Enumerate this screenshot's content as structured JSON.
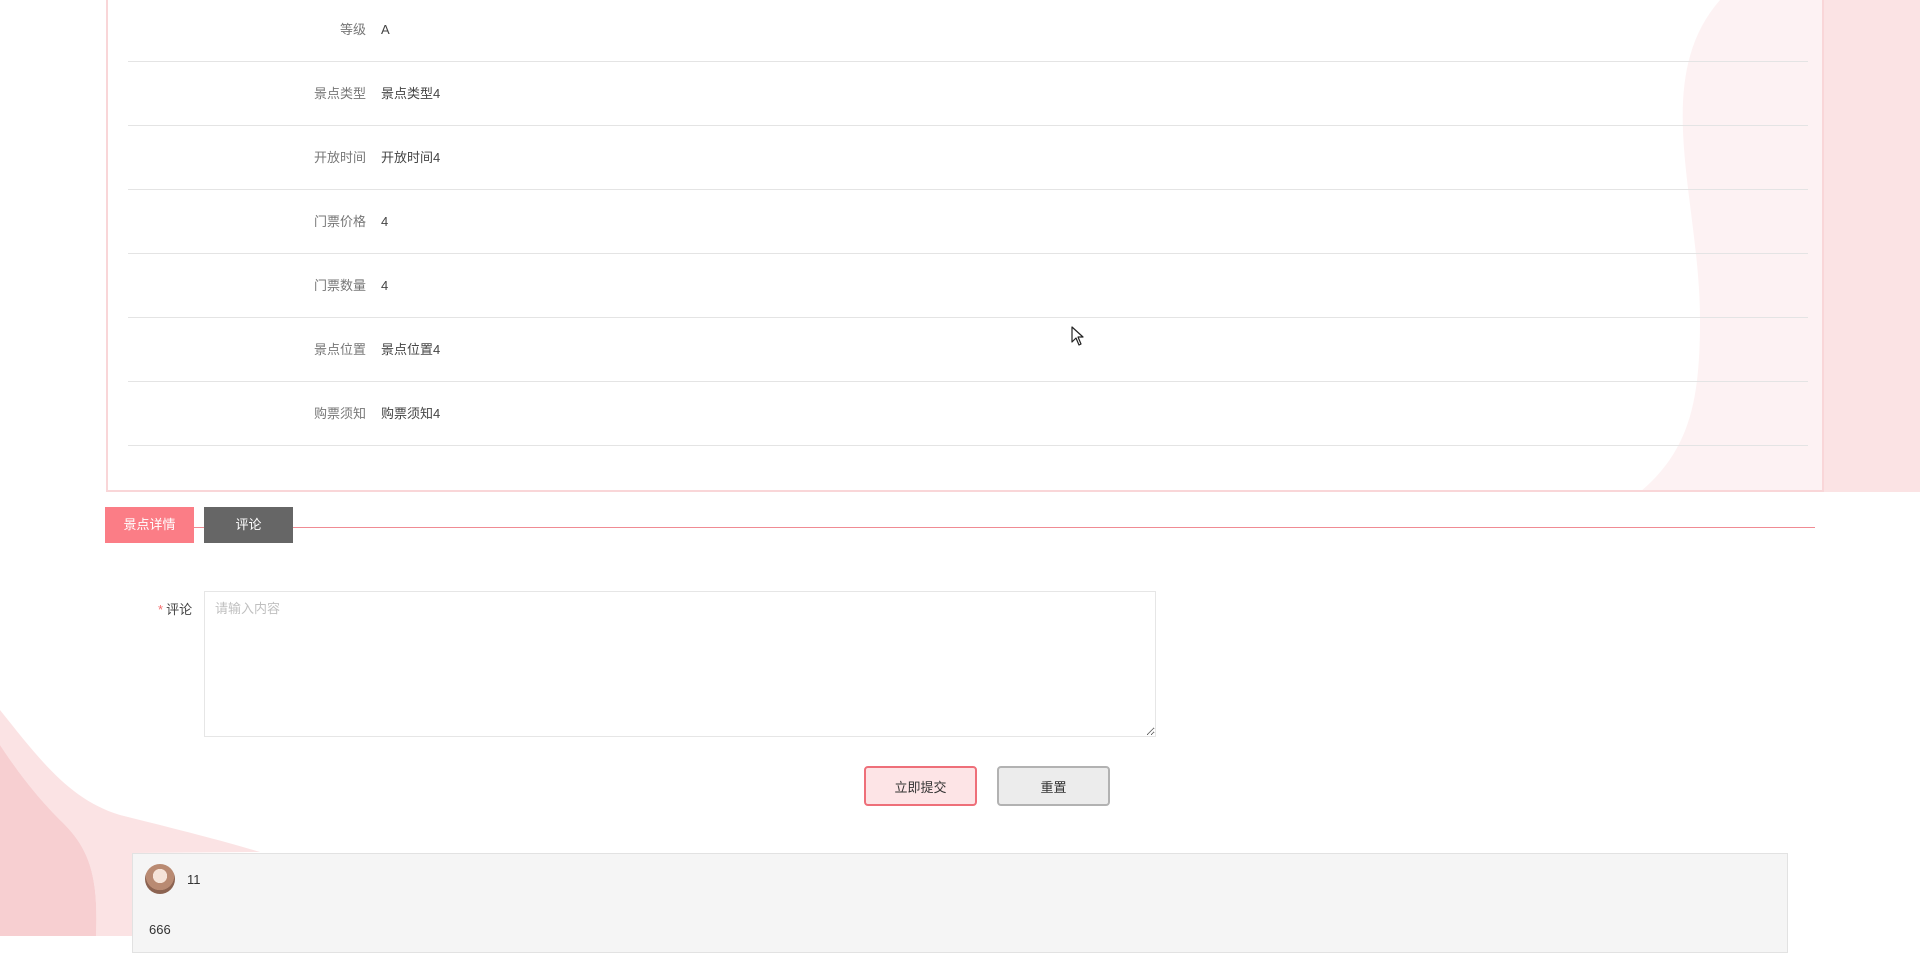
{
  "colors": {
    "accent": "#fb7d86",
    "tab_inactive": "#666666",
    "required": "#f56c6c",
    "background_shape": "#fbe3e4"
  },
  "detail": {
    "rows": [
      {
        "label": "等级",
        "value": "A"
      },
      {
        "label": "景点类型",
        "value": "景点类型4"
      },
      {
        "label": "开放时间",
        "value": "开放时间4"
      },
      {
        "label": "门票价格",
        "value": "4"
      },
      {
        "label": "门票数量",
        "value": "4"
      },
      {
        "label": "景点位置",
        "value": "景点位置4"
      },
      {
        "label": "购票须知",
        "value": "购票须知4"
      }
    ]
  },
  "tabs": [
    {
      "label": "景点详情",
      "active": true
    },
    {
      "label": "评论",
      "active": false
    }
  ],
  "comment_form": {
    "required_mark": "*",
    "label": "评论",
    "placeholder": "请输入内容",
    "value": "",
    "submit_label": "立即提交",
    "reset_label": "重置"
  },
  "comments": [
    {
      "user": "11",
      "content": "666"
    }
  ]
}
